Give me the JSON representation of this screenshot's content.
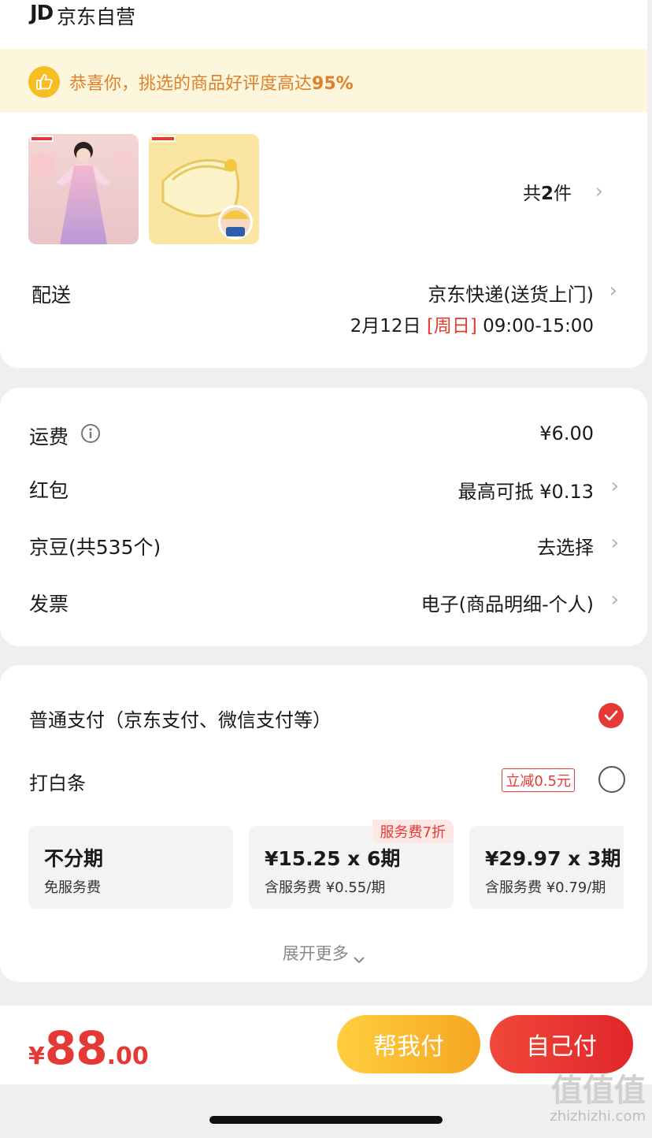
{
  "store": {
    "logo": "JD",
    "name": "京东自营"
  },
  "banner": {
    "prefix": "恭喜你，挑选的商品好评度高达",
    "rate": "95%"
  },
  "products": {
    "count_prefix": "共",
    "count": "2",
    "count_suffix": "件"
  },
  "delivery": {
    "label": "配送",
    "method": "京东快递(送货上门)",
    "date": "2月12日",
    "weekday": "[周日]",
    "time": "09:00-15:00"
  },
  "fees": [
    {
      "label": "运费",
      "value": "¥6.00"
    },
    {
      "label": "红包",
      "value": "最高可抵 ¥0.13"
    },
    {
      "label": "京豆(共535个)",
      "value": "去选择"
    },
    {
      "label": "发票",
      "value": "电子(商品明细-个人)"
    }
  ],
  "payment": {
    "normal_label": "普通支付（京东支付、微信支付等）",
    "baitiao_label": "打白条",
    "baitiao_promo": "立减0.5元",
    "installments": [
      {
        "title": "不分期",
        "sub": "免服务费",
        "badge": ""
      },
      {
        "title": "¥15.25 x 6期",
        "sub": "含服务费 ¥0.55/期",
        "badge": "服务费7折"
      },
      {
        "title": "¥29.97 x 3期",
        "sub": "含服务费 ¥0.79/期",
        "badge": ""
      }
    ],
    "expand_label": "展开更多"
  },
  "bottom": {
    "currency": "¥",
    "price_int": "88",
    "price_dec": ".00",
    "help_pay": "帮我付",
    "self_pay": "自己付"
  },
  "watermark": {
    "logo": "值值值",
    "site": "zhizhizhi.com"
  },
  "colors": {
    "accent": "#e53935",
    "banner_bg": "#fbf6dc",
    "banner_text": "#e0802a",
    "gold": "#f5a623"
  },
  "icons": {
    "banner": "thumbs-up-icon",
    "info": "info-icon",
    "chevron": "chevron-right-icon",
    "check": "check-circle-icon",
    "expand": "chevron-down-icon"
  }
}
